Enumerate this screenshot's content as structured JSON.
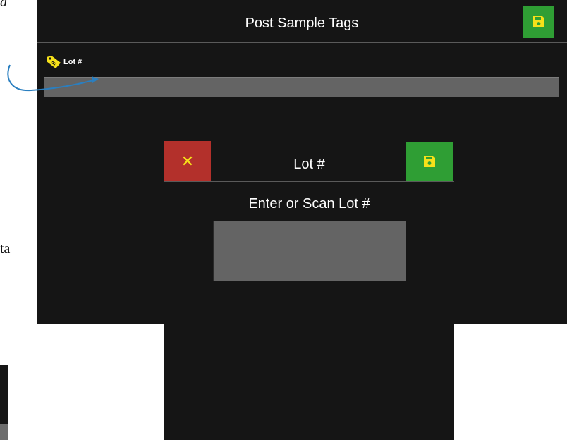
{
  "document": {
    "top_fragment": "d",
    "mid_fragment": "ta"
  },
  "screen": {
    "title": "Post Sample Tags",
    "save_icon": "floppy-disk-icon",
    "field": {
      "label": "Lot #",
      "icon": "tag-icon",
      "value": ""
    }
  },
  "dialog": {
    "title": "Lot #",
    "cancel_icon": "close-icon",
    "cancel_symbol": "✕",
    "save_icon": "floppy-disk-icon",
    "prompt": "Enter or Scan Lot #",
    "input_value": ""
  },
  "colors": {
    "background": "#151515",
    "save_green": "#2f9e34",
    "cancel_red": "#b3302b",
    "accent_yellow": "#f6e11a",
    "input_gray": "#646464",
    "arrow_blue": "#2a7fc0"
  }
}
